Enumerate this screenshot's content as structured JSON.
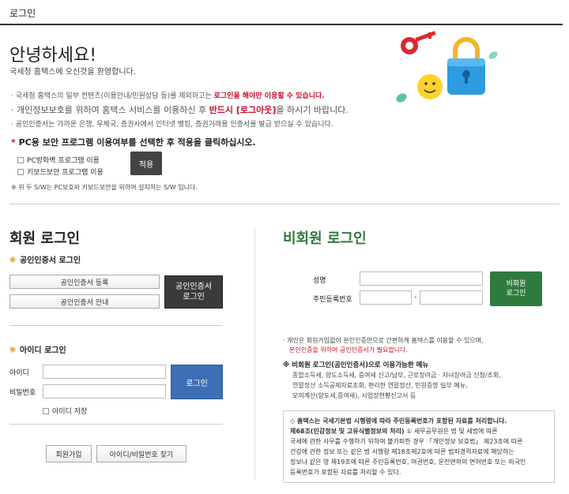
{
  "header": {
    "title": "로그인"
  },
  "greeting": {
    "title": "안녕하세요!",
    "subtitle": "국세청 홈택스에 오신것을 환영합니다."
  },
  "notices": {
    "n1_pre": "국세청 홈택스의 일부 컨텐츠(이용안내/민원상담 등)를 제외하고는 ",
    "n1_red": "로그인을 해야만 이용할 수 있습니다.",
    "n2_pre": "개인정보보호를 위하여 홈택스 서비스를 이용하신 후 ",
    "n2_red": "반드시 [로그아웃]",
    "n2_post": "을 하시기 바랍니다.",
    "n3": "공인인증서는 가까운 은행, 우체국, 증권사에서 인터넷 뱅킹, 증권거래용 인증서를 발급 받으실 수 있습니다."
  },
  "pc_security": {
    "title_star": "*",
    "title": "PC용 보안 프로그램 이용여부를 선택한 후 적용을 클릭하십시오.",
    "option1": "PC방화벽 프로그램 이용",
    "option2": "키보드보안 프로그램 이용",
    "apply_label": "적용",
    "footnote": "※ 위 두 S/W는 PC보호와 키보드보안을 위하여 설치하는 S/W 입니다."
  },
  "member": {
    "title": "회원 로그인",
    "cert_section": "공인인증서 로그인",
    "cert_register": "공인인증서 등록",
    "cert_guide": "공인인증서 안내",
    "cert_login_l1": "공인인증서",
    "cert_login_l2": "로그인",
    "id_section": "아이디 로그인",
    "id_label": "아이디",
    "pw_label": "비밀번호",
    "login_button": "로그인",
    "save_id": "아이디 저장",
    "join_button": "회원가입",
    "find_button": "아이디/비밀번호 찾기"
  },
  "nonmember": {
    "title": "비회원 로그인",
    "name_label": "성명",
    "rrn_label": "주민등록번호",
    "dash": "-",
    "login_l1": "비회원",
    "login_l2": "로그인",
    "note1": "개인은 회원가입없이 본인인증만으로 간편하게 홈택스를 이용할 수 있으며,",
    "note2": "본인인증을 위하여 공인인증서가 필요합니다.",
    "menu_title": "※ 비회원 로그인(공인인증서)으로 이용가능한 메뉴",
    "menu1": "종합소득세, 양도소득세, 증여세 신고/납부, 근로장려금ㆍ자녀장려금 신청/조회,",
    "menu2": "연말정산 소득공제자료조회, 편리한 연말정산, 민원증명 일부 메뉴,",
    "menu3": "모의계산(양도세,증여세), 사업장현황신고서 등"
  },
  "info": {
    "head": "◇ 홈택스는 국세기본법 시행령에 따라 주민등록번호가 포함된 자료를 처리합니다.",
    "head2": "제68조(민감정보 및 고유식별정보의 처리)",
    "l1": " ① 세무공무원은 법 및 세법에 따른",
    "l2": "국세에 관한 사무를 수행하기 위하여 불가피한 경우 「개인정보 보호법」 제23조에 따른",
    "l3": "건강에 관한 정보 또는 같은 법 시행령 제18조제2호에 따른 범죄경력자료에 해당하는",
    "l4": "정보나 같은 영 제19조에 따른 주민등록번호, 여권번호, 운전면허의 면허번호 또는 외국인",
    "l5": "등록번호가 포함된 자료를 처리할 수 있다."
  },
  "colors": {
    "accent_red": "#c8102e",
    "member_title": "#222222",
    "nonmember_title": "#2f7b3e",
    "login_blue": "#3e6fb4"
  }
}
